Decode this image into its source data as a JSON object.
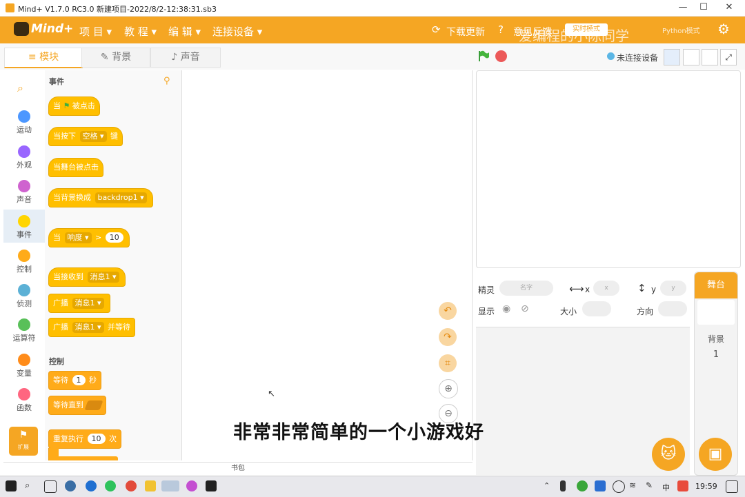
{
  "window": {
    "title": "Mind+ V1.7.0 RC3.0   新建项目-2022/8/2-12:38:31.sb3",
    "min": "—",
    "max": "☐",
    "close": "✕"
  },
  "menubar": {
    "logo": "Mind+",
    "items": [
      "项 目 ▾",
      "教 程 ▾",
      "编 辑 ▾",
      "连接设备 ▾"
    ],
    "download": "下载更新",
    "help": "意见反馈",
    "mode": "实时模式",
    "python": "Python模式",
    "watermark": "爱编程的小陈同学"
  },
  "tabs": [
    "模块",
    "背景",
    "声音"
  ],
  "toolbar": {
    "connect_status": "未连接设备"
  },
  "categories": [
    {
      "label": "运动",
      "color": "#4c97ff"
    },
    {
      "label": "外观",
      "color": "#9966ff"
    },
    {
      "label": "声音",
      "color": "#cf63cf"
    },
    {
      "label": "事件",
      "color": "#ffd500"
    },
    {
      "label": "控制",
      "color": "#ffab19"
    },
    {
      "label": "侦测",
      "color": "#5cb1d6"
    },
    {
      "label": "运算符",
      "color": "#59c059"
    },
    {
      "label": "变量",
      "color": "#ff8c1a"
    },
    {
      "label": "函数",
      "color": "#ff6680"
    }
  ],
  "extension_label": "扩展",
  "palette": {
    "events_header": "事件",
    "control_header": "控制",
    "blocks": {
      "when_flag_a": "当",
      "when_flag_b": "被点击",
      "key_a": "当按下",
      "key_dd": "空格 ▾",
      "key_b": "键",
      "stage_click": "当舞台被点击",
      "backdrop_a": "当背景换成",
      "backdrop_dd": "backdrop1 ▾",
      "loud_a": "当",
      "loud_dd": "响度 ▾",
      "loud_op": ">",
      "loud_val": "10",
      "recv_a": "当接收到",
      "recv_dd": "消息1 ▾",
      "bc_a": "广播",
      "bc_dd": "消息1 ▾",
      "bcw_a": "广播",
      "bcw_dd": "消息1 ▾",
      "bcw_b": "并等待",
      "wait_a": "等待",
      "wait_val": "1",
      "wait_b": "秒",
      "until_a": "等待直到",
      "repeat_a": "重复执行",
      "repeat_val": "10",
      "repeat_b": "次"
    }
  },
  "bag_label": "书包",
  "sprite_info": {
    "sprite_label": "精灵",
    "name_placeholder": "名字",
    "x_label": "x",
    "x_placeholder": "x",
    "y_label": "y",
    "y_placeholder": "y",
    "show_label": "显示",
    "size_label": "大小",
    "direction_label": "方向"
  },
  "stage_pane": {
    "header": "舞台",
    "backdrops_label": "背景",
    "backdrops_count": "1"
  },
  "subtitle": "非常非常简单的一个小游戏好",
  "taskbar": {
    "ime": "中",
    "time": "19:59"
  }
}
